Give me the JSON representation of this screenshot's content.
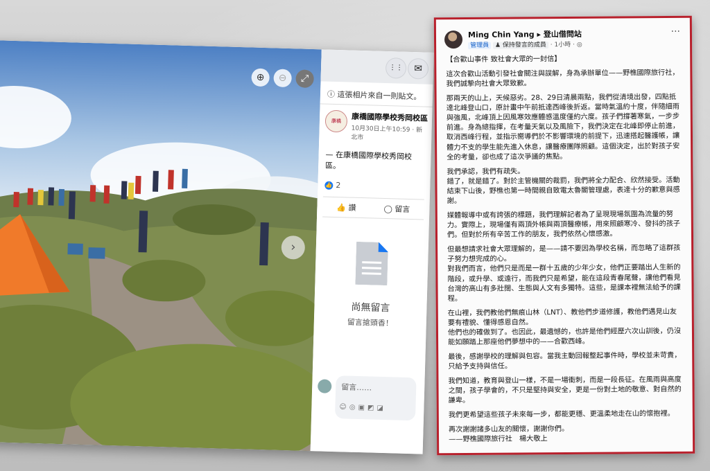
{
  "viewer": {
    "notice": "這張相片來自一則貼文。",
    "page_name": "康橋國際學校秀岡校區",
    "page_logo_text": "康橋",
    "post_time": "10月30日上午10:59 · 新北市",
    "post_text": "— 在康橋國際學校秀岡校區。",
    "like_count": "2",
    "like_label": "讚",
    "comment_label": "留言",
    "no_comments_title": "尚無留言",
    "no_comments_sub": "留言搶頭香！",
    "comment_placeholder": "留言……",
    "comment_tools": "☺◎▣◩◪",
    "icons": {
      "zoom_in": "⊕",
      "zoom_out": "⊖",
      "fullscreen": "⤢",
      "menu": "⋮⋮",
      "messenger": "✉",
      "next": "›"
    }
  },
  "post": {
    "author": "Ming Chin Yang",
    "group": "登山借問站",
    "role_badge": "管理員",
    "member_badge": "保持發言的成員",
    "time": "1小時",
    "more_icon": "···",
    "paragraphs": [
      "【合歡山事件 致社會大眾的一封信】",
      "這次合歡山活動引發社會關注與誤解，身為承辦單位——野樵國際旅行社，我們誠摯向社會大眾致歉。",
      "那兩天的山上，天候惡劣。28、29日清晨兩點，我們從清境出發，四點抵達北峰登山口，原計畫中午前抵達西峰後折返。當時氣溫約十度，伴隨細雨與強風，北峰頂上因風寒效應體感溫度僅約六度。孩子們撐著寒氣，一步步前進。身為總指揮，在考量天氣以及風險下，我們決定在北峰即停止前進，取消西峰行程，並指示嚮導們於不影響環境的前提下，迅速搭起醫護帳，讓體力不支的學生能先進入休息，讓醫療團隊照顧。這個決定，出於對孩子安全的考量，卻也成了這次爭議的焦點。",
      "我們承認，我們有疏失。\n錯了，就是錯了。對於主管機關的裁罰，我們將全力配合、欣然接受。活動結束下山後，野樵也第一時間親自致電太魯閣管理處，表達十分的歉意與感謝。",
      "媒體報導中或有誇張的標題，我們理解記者為了呈現現場氛圍為流量的努力。實際上，現場僅有兩頂外帳與兩頂醫療帳，用來照顧寒冷、發抖的孩子們。但對於所有辛苦工作的朋友，我們依然心懷感激。",
      "但最想請求社會大眾理解的，是——請不要因為學校名稱，而忽略了這群孩子努力想完成的心。\n對我們而言，他們只是而是一群十五歲的少年少女，他們正要踏出人生新的階段，或升學、或遠行，而我們只是希望，能在這段青春尾聲，讓他們看見台灣的高山有多壯闊、生態與人文有多獨特。這些，是課本裡無法給予的課程。",
      "在山裡，我們教他們無痕山林（LNT）、教他們步道修護，教他們遇見山友要有禮貌、懂得感恩自然。\n他們也的確做到了。也因此，最遺憾的，也許是他們經歷六次山訓後，仍沒能如願踏上那座他們夢想中的——合歡西峰。",
      "最後，感謝學校的理解與包容。當我主動回報整起事件時，學校並未苛責，只給予支持與信任。",
      "我們知道，教育與登山一樣，不是一場衝刺，而是一段長征。在風雨與高度之間，孩子學會的，不只是堅持與安全，更是一份對土地的敬意、對自然的謙卑。",
      "我們更希望這些孩子未來每一步，都能更穩、更溫柔地走在山的懷抱裡。",
      "再次謝謝諸多山友的關懷，謝謝你們。\n——野樵國際旅行社　楊大敬上"
    ]
  },
  "colors": {
    "frame_red": "#b8202c",
    "fb_blue": "#1877f2",
    "tent_orange": "#f07a2a"
  }
}
